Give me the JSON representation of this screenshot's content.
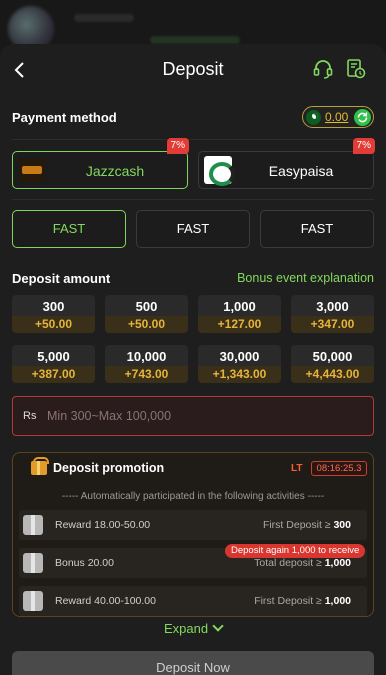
{
  "header": {
    "title": "Deposit"
  },
  "payment": {
    "label": "Payment method",
    "balance": "0.00",
    "methods": [
      {
        "name": "Jazzcash",
        "badge": "7%"
      },
      {
        "name": "Easypaisa",
        "badge": "7%"
      }
    ]
  },
  "channels": [
    "FAST",
    "FAST",
    "FAST"
  ],
  "amount_section": {
    "label": "Deposit amount",
    "bonus_link": "Bonus event explanation",
    "amounts": [
      {
        "value": "300",
        "bonus": "+50.00"
      },
      {
        "value": "500",
        "bonus": "+50.00"
      },
      {
        "value": "1,000",
        "bonus": "+127.00"
      },
      {
        "value": "3,000",
        "bonus": "+347.00"
      },
      {
        "value": "5,000",
        "bonus": "+387.00"
      },
      {
        "value": "10,000",
        "bonus": "+743.00"
      },
      {
        "value": "30,000",
        "bonus": "+1,343.00"
      },
      {
        "value": "50,000",
        "bonus": "+4,443.00"
      }
    ],
    "input_prefix": "Rs",
    "input_placeholder": "Min 300~Max 100,000"
  },
  "promotion": {
    "title": "Deposit promotion",
    "lt_label": "LT",
    "timer": "08:16:25.3",
    "subtitle": "----- Automatically participated in the following activities -----",
    "tooltip": "Deposit again 1,000 to receive",
    "rows": [
      {
        "title": "Reward 18.00-50.00",
        "cond_text": "First Deposit ≥ ",
        "cond_value": "300"
      },
      {
        "title": "Bonus 20.00",
        "cond_text": "Total deposit ≥ ",
        "cond_value": "1,000"
      },
      {
        "title": "Reward 40.00-100.00",
        "cond_text": "First Deposit ≥ ",
        "cond_value": "1,000"
      }
    ]
  },
  "expand_label": "Expand",
  "deposit_button": "Deposit Now",
  "colors": {
    "accent": "#83d85e",
    "bonus": "#e6b43a",
    "badge": "#e23c36",
    "error": "#b23a36"
  }
}
